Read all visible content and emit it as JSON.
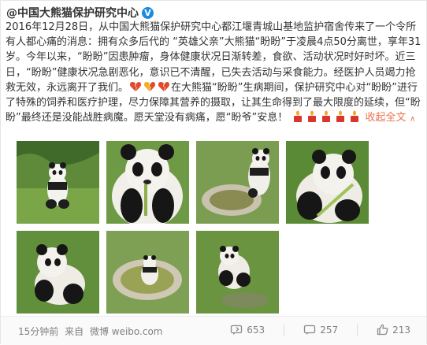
{
  "post": {
    "author": "@中国大熊猫保护研究中心",
    "verified_badge": "V",
    "text_segments": [
      "2016年12月28日，从中国大熊猫保护研究中心都江堰青城山基地监护宿舍传来了一个令所有人都心痛的消息：拥有众多后代的 “英雄父亲”大熊猫“盼盼”于凌晨4点50分离世，享年31岁。今年以来，“盼盼”因患肿瘤，身体健康状况日渐转差，食欲、活动状况时好时坏。近三日，“盼盼”健康状况急剧恶化，意识已不清醒，已失去活动与采食能力。经医护人员竭力抢救无效，永远离开了我们。",
      "在大熊猫“盼盼”生病期间，保护研究中心对“盼盼”进行了特殊的饲养和医疗护理，尽力保障其营养的摄取，让其生命得到了最大限度的延续，但“盼盼”最终还是没能战胜病魔。愿天堂没有病痛，愿“盼爷”安息！"
    ],
    "collapse_link": "收起全文",
    "collapse_arrow": "∨",
    "emoji_icons": [
      "broken-heart-icon",
      "candle-icon"
    ]
  },
  "photos": [
    {
      "name": "photo-panda-sitting-grass",
      "scene": "grass-sitting"
    },
    {
      "name": "photo-panda-closeup-eating",
      "scene": "closeup"
    },
    {
      "name": "photo-panda-by-pool",
      "scene": "pool-rocks"
    },
    {
      "name": "photo-panda-eating-bamboo",
      "scene": "bamboo"
    },
    {
      "name": "photo-panda-lying-grass",
      "scene": "lying"
    },
    {
      "name": "photo-panda-in-pool",
      "scene": "pool"
    },
    {
      "name": "photo-panda-resting-grass",
      "scene": "resting"
    }
  ],
  "footer": {
    "time": "15分钟前",
    "source_prefix": "来自",
    "source": "微博 weibo.com",
    "reposts": "653",
    "comments": "257",
    "likes": "213"
  },
  "colors": {
    "link": "#eb7350",
    "verified": "#1a8ce0",
    "text": "#333333",
    "meta": "#808080"
  }
}
